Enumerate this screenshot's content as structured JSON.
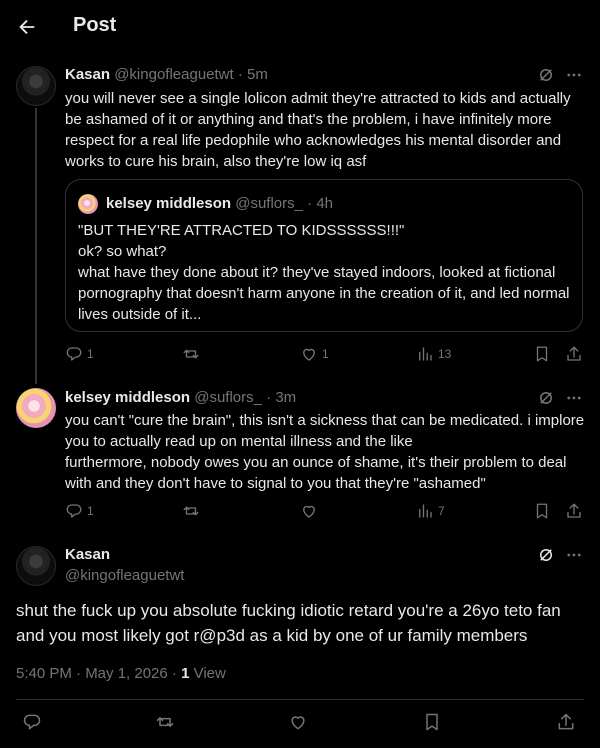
{
  "header": {
    "title": "Post"
  },
  "reply1": {
    "name": "Kasan",
    "handle": "@kingofleaguetwt",
    "time": "5m",
    "text": "you will never see a single lolicon admit they're attracted to kids and actually be ashamed of it or anything and that's the problem, i have infinitely more respect for a real life pedophile who acknowledges his mental disorder and works to cure his brain, also they're low iq asf",
    "quote": {
      "name": "kelsey middleson",
      "handle": "@suflors_",
      "time": "4h",
      "text": "\"BUT THEY'RE ATTRACTED TO KIDSSSSSS!!!\"\nok? so what?\nwhat have they done about it? they've stayed indoors, looked at fictional pornography that doesn't harm anyone in the creation of it, and led normal lives outside of it..."
    },
    "stats": {
      "replies": "1",
      "retweets": "",
      "likes": "1",
      "views": "13"
    }
  },
  "reply2": {
    "name": "kelsey middleson",
    "handle": "@suflors_",
    "time": "3m",
    "text": "you can't \"cure the brain\", this isn't a sickness that can be medicated. i implore you to actually read up on mental illness and the like\nfurthermore, nobody owes you an ounce of shame, it's their problem to deal with and they don't have to signal to you that they're \"ashamed\"",
    "stats": {
      "replies": "1",
      "retweets": "",
      "likes": "",
      "views": "7"
    }
  },
  "main": {
    "name": "Kasan",
    "handle": "@kingofleaguetwt",
    "text": "shut the fuck up you absolute fucking idiotic retard you're a 26yo teto fan and you most likely got r@p3d as a kid by one of ur family members",
    "timestamp": "5:40 PM · May 1, 2026 · ",
    "views_count": "1",
    "views_label": " View"
  },
  "icons": {
    "back": "arrow-left-icon",
    "grok": "grok-icon",
    "more": "more-dots-icon",
    "reply": "reply-icon",
    "retweet": "retweet-icon",
    "like": "heart-icon",
    "views": "views-chart-icon",
    "bookmark": "bookmark-icon",
    "share": "share-icon"
  },
  "colors": {
    "background": "#000000",
    "text": "#e7e9ea",
    "muted": "#71767b",
    "border": "#2f3336"
  }
}
